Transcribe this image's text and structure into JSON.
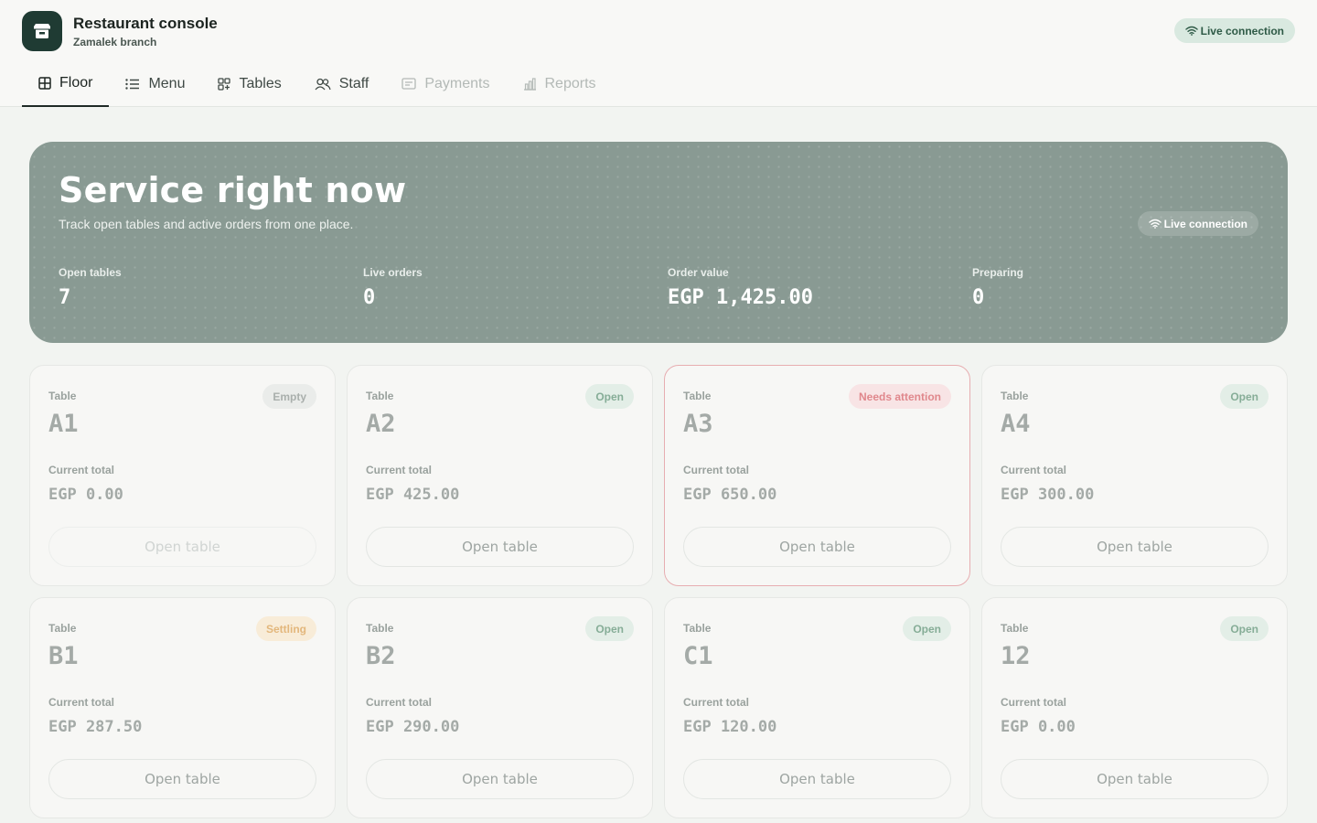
{
  "app": {
    "title": "Restaurant console",
    "branch": "Zamalek branch",
    "connection_label": "Live connection"
  },
  "tabs": [
    {
      "label": "Floor",
      "icon": "grid-icon",
      "state": "active"
    },
    {
      "label": "Menu",
      "icon": "list-icon",
      "state": "enabled"
    },
    {
      "label": "Tables",
      "icon": "tables-icon",
      "state": "enabled"
    },
    {
      "label": "Staff",
      "icon": "people-icon",
      "state": "enabled"
    },
    {
      "label": "Payments",
      "icon": "receipt-icon",
      "state": "disabled"
    },
    {
      "label": "Reports",
      "icon": "bar-chart-icon",
      "state": "disabled"
    }
  ],
  "hero": {
    "title": "Service right now",
    "subtitle": "Track open tables and active orders from one place.",
    "connection_label": "Live connection",
    "stats": [
      {
        "label": "Open tables",
        "value": "7"
      },
      {
        "label": "Live orders",
        "value": "0"
      },
      {
        "label": "Order value",
        "value": "EGP 1,425.00"
      },
      {
        "label": "Preparing",
        "value": "0"
      }
    ]
  },
  "cards": [
    {
      "label": "Table",
      "name": "A1",
      "status": "Empty",
      "total_label": "Current total",
      "total": "EGP 0.00",
      "button": "Open table"
    },
    {
      "label": "Table",
      "name": "A2",
      "status": "Open",
      "total_label": "Current total",
      "total": "EGP 425.00",
      "button": "Open table"
    },
    {
      "label": "Table",
      "name": "A3",
      "status": "Needs attention",
      "total_label": "Current total",
      "total": "EGP 650.00",
      "button": "Open table"
    },
    {
      "label": "Table",
      "name": "A4",
      "status": "Open",
      "total_label": "Current total",
      "total": "EGP 300.00",
      "button": "Open table"
    },
    {
      "label": "Table",
      "name": "B1",
      "status": "Settling",
      "total_label": "Current total",
      "total": "EGP 287.50",
      "button": "Open table"
    },
    {
      "label": "Table",
      "name": "B2",
      "status": "Open",
      "total_label": "Current total",
      "total": "EGP 290.00",
      "button": "Open table"
    },
    {
      "label": "Table",
      "name": "C1",
      "status": "Open",
      "total_label": "Current total",
      "total": "EGP 120.00",
      "button": "Open table"
    },
    {
      "label": "Table",
      "name": "12",
      "status": "Open",
      "total_label": "Current total",
      "total": "EGP 0.00",
      "button": "Open table"
    }
  ],
  "colors": {
    "brand": "#1f3b33",
    "hero_background": "#899a93",
    "status_open": "#86ad97",
    "status_attention": "#e0878c",
    "status_settling": "#e3b77c",
    "status_empty": "#a9afac"
  }
}
